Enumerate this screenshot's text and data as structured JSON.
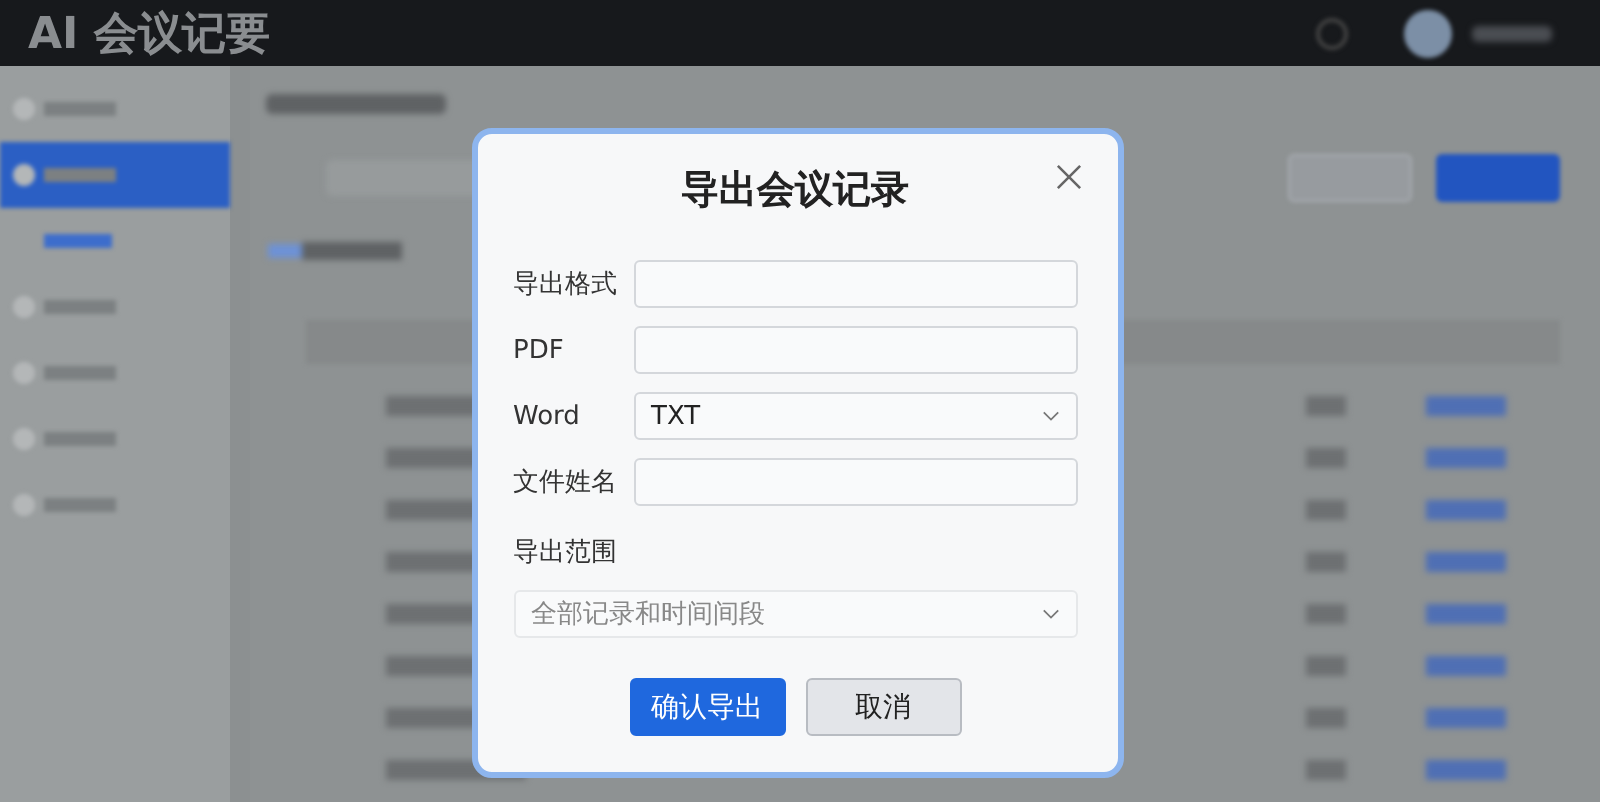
{
  "header": {
    "title": "AI 会议记要"
  },
  "sidebar": {
    "items": [
      {
        "selected": false
      },
      {
        "selected": true
      },
      {
        "selected": false
      },
      {
        "selected": false
      },
      {
        "selected": false
      },
      {
        "selected": false
      },
      {
        "selected": false
      }
    ]
  },
  "dialog": {
    "title": "导出会议记录",
    "fields": [
      {
        "label": "导出格式",
        "kind": "input"
      },
      {
        "label": "PDF",
        "kind": "input"
      },
      {
        "label": "Word",
        "kind": "select",
        "value": "TXT"
      },
      {
        "label": "文件姓名",
        "kind": "input"
      }
    ],
    "range": {
      "label": "导出范围",
      "placeholder": "全部记录和时间间段"
    },
    "buttons": [
      {
        "label": "确认导出",
        "kind": "primary"
      },
      {
        "label": "取消",
        "kind": "secondary"
      }
    ]
  }
}
